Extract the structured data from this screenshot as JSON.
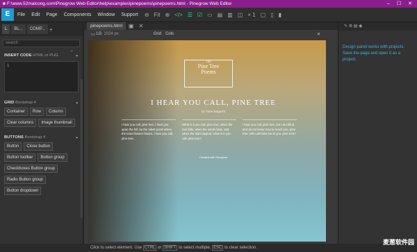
{
  "window": {
    "path_title": "F:\\www.52maicong.com\\Pinegrow Web Editor\\help\\examples\\pinepoems\\pinepoems.html - Pinegrow Web Editor",
    "min": "–",
    "max": "☐",
    "close": "✕"
  },
  "menu": [
    "File",
    "Edit",
    "Page",
    "Components",
    "Window",
    "Support"
  ],
  "toolbar": {
    "zoom_out": "⊖",
    "fit": "Fit",
    "zoom_in": "⊕",
    "multiplier": "× 1"
  },
  "left_panel": {
    "tabs": [
      "L",
      "BL...",
      "COMP..."
    ],
    "search_placeholder": "search",
    "insert_code": {
      "title": "INSERT CODE",
      "sub": "HTML or PUG",
      "line": "1"
    },
    "grid": {
      "title": "GRID",
      "sub": "Bootstrap 4",
      "items": [
        "Container",
        "Row",
        "Column",
        "Clear columns",
        "Image thumbnail"
      ]
    },
    "buttons": {
      "title": "BUTTONS",
      "sub": "Bootstrap 4",
      "items": [
        "Button",
        "Close button",
        "Button toolbar",
        "Button group",
        "Checkboxes Button group",
        "Radio Button group",
        "Button dropdown"
      ]
    }
  },
  "editor": {
    "tab": "pinepoems.html",
    "viewport": "LG",
    "width": "1024 px",
    "grid": "Grid",
    "cols": "Cols"
  },
  "preview": {
    "the": "The",
    "name_line1": "Pine Tree",
    "name_line2": "Poems",
    "heading": "I HEAR YOU CALL, PINE TREE",
    "byline": "by Yone Noguchi",
    "col1": "I hear you call, pine tree, I hear you upon the hill, by the silent pond where the lotus flowers bloom, I hear you call, pine tree.",
    "col2": "What is it you call, pine tree, when the rain falls, when the winds blow, and when the stars appear, what is it you call, pine tree?",
    "col3": "I hear you call, pine tree, but I am blind, and do not know how to reach you, pine tree. Who will take me to you, pine tree?",
    "credit": "Created with Pinegrow"
  },
  "right_panel": {
    "message": "Design panel works with projects. Save the page and open it as a project."
  },
  "status": {
    "pre": "Click to select element. Use",
    "k1": "CTRL",
    "mid1": "or",
    "k2": "SHIFT",
    "mid2": "to select multiple.",
    "k3": "ESC",
    "post": "to clear selection."
  },
  "watermark": "麦葱软件园"
}
